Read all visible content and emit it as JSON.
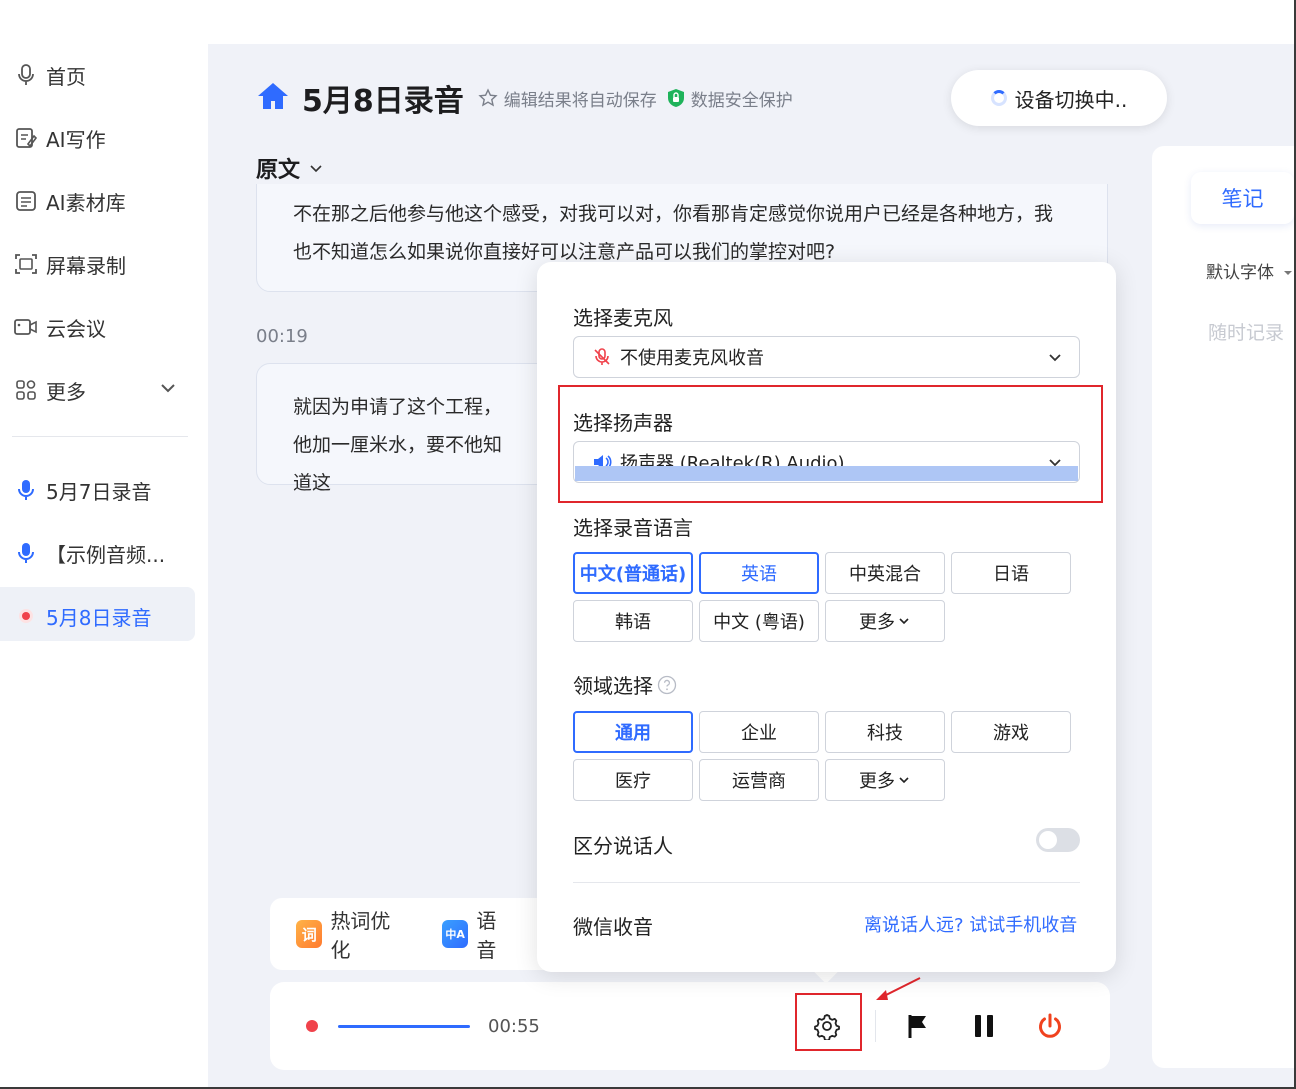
{
  "sidebar": {
    "items": [
      {
        "label": "首页",
        "icon": "mic-outline-icon"
      },
      {
        "label": "AI写作",
        "icon": "edit-doc-icon"
      },
      {
        "label": "AI素材库",
        "icon": "library-icon"
      },
      {
        "label": "屏幕录制",
        "icon": "screen-record-icon"
      },
      {
        "label": "云会议",
        "icon": "video-camera-icon"
      },
      {
        "label": "更多",
        "icon": "grid-icon"
      }
    ],
    "recordings": [
      {
        "label": "5月7日录音"
      },
      {
        "label": "【示例音频..."
      },
      {
        "label": "5月8日录音"
      }
    ]
  },
  "header": {
    "title": "5月8日录音",
    "autosave": "编辑结果将自动保存",
    "security": "数据安全保护",
    "device_status": "设备切换中.."
  },
  "transcript": {
    "tab_label": "原文",
    "para1": "不在那之后他参与他这个感受，对我可以对，你看那肯定感觉你说用户已经是各种地方，我也不知道怎么如果说你直接好可以注意产品可以我们的掌控对吧?",
    "timestamp": "00:19",
    "para2": "就因为申请了这个工程，他加一厘米水，要不他知道这"
  },
  "notes": {
    "tab": "笔记",
    "font": "默认字体",
    "placeholder": "随时记录"
  },
  "tools": {
    "hotword": "热词优化",
    "hotword_badge": "词",
    "lang_tool": "语音",
    "lang_badge": "中A"
  },
  "player": {
    "time": "00:55"
  },
  "settings_popup": {
    "mic_label": "选择麦克风",
    "mic_value": "不使用麦克风收音",
    "speaker_label": "选择扬声器",
    "speaker_value": "扬声器 (Realtek(R) Audio)",
    "language_label": "选择录音语言",
    "languages": [
      "中文(普通话)",
      "英语",
      "中英混合",
      "日语",
      "韩语",
      "中文 (粤语)",
      "更多"
    ],
    "domain_label": "领域选择",
    "domains": [
      "通用",
      "企业",
      "科技",
      "游戏",
      "医疗",
      "运营商",
      "更多"
    ],
    "speaker_sep_label": "区分说话人",
    "speaker_sep_on": false,
    "wechat_label": "微信收音",
    "wechat_link": "离说话人远? 试试手机收音"
  },
  "colors": {
    "accent": "#2f6bff",
    "record_red": "#f0424b",
    "highlight_red": "#e0262c"
  }
}
